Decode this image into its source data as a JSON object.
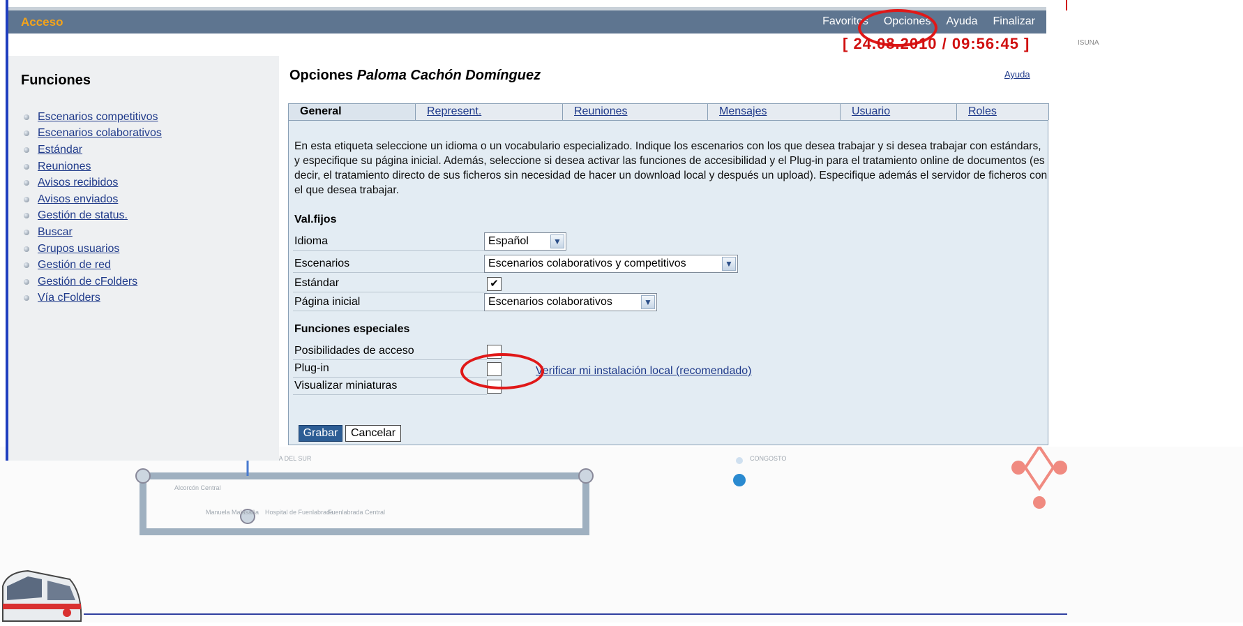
{
  "topbar": {
    "left_label": "Acceso",
    "nav": [
      "Favoritos",
      "Opciones",
      "Ayuda",
      "Finalizar"
    ]
  },
  "datetime": "[ 24.08.2010 / 09:56:45 ]",
  "side_text": "ISUNA",
  "functions": {
    "title": "Funciones",
    "items": [
      "Escenarios competitivos",
      "Escenarios colaborativos",
      "Estándar",
      "Reuniones",
      "Avisos recibidos",
      "Avisos enviados",
      "Gestión de status.",
      "Buscar",
      "Grupos usuarios",
      "Gestión de red",
      "Gestión de cFolders",
      "Vía cFolders"
    ]
  },
  "main": {
    "title_prefix": "Opciones",
    "title_name": "Paloma Cachón Domínguez",
    "help_link": "Ayuda",
    "tabs": [
      "General",
      "Represent.",
      "Reuniones",
      "Mensajes",
      "Usuario",
      "Roles"
    ],
    "description": "En esta etiqueta seleccione un idioma o un vocabulario especializado. Indique los escenarios con los que desea trabajar y si desea trabajar con estándars, y especifique su página inicial. Además, seleccione si desea activar las funciones de accesibilidad y el Plug-in para el tratamiento online de documentos (es decir, el tratamiento directo de sus ficheros sin necesidad de hacer un download local y después un upload). Especifique además el servidor de ficheros con el que desea trabajar.",
    "section_fixed": "Val.fijos",
    "fields": {
      "idioma_label": "Idioma",
      "idioma_value": "Español",
      "escenarios_label": "Escenarios",
      "escenarios_value": "Escenarios colaborativos y competitivos",
      "estandar_label": "Estándar",
      "estandar_checked": true,
      "pagina_label": "Página inicial",
      "pagina_value": "Escenarios colaborativos"
    },
    "section_special": "Funciones especiales",
    "special": {
      "acceso_label": "Posibilidades de acceso",
      "plugin_label": "Plug-in",
      "miniaturas_label": "Visualizar miniaturas",
      "verify_link": "Verificar mi instalación local (recomendado)"
    },
    "buttons": {
      "save": "Grabar",
      "cancel": "Cancelar"
    }
  },
  "map_labels": [
    "PUERTA DEL SUR",
    "CONGOSTO",
    "Alcorcón Central",
    "Manuela Malasaña",
    "Hospital de Fuenlabrada",
    "Fuenlabrada Central"
  ],
  "colors": {
    "topbar": "#5e7590",
    "accent_orange": "#f3a31a",
    "datetime_red": "#d01010",
    "annotation_red": "#e01818",
    "content_bg": "#e3ecf3",
    "button_blue": "#2c5d94"
  }
}
